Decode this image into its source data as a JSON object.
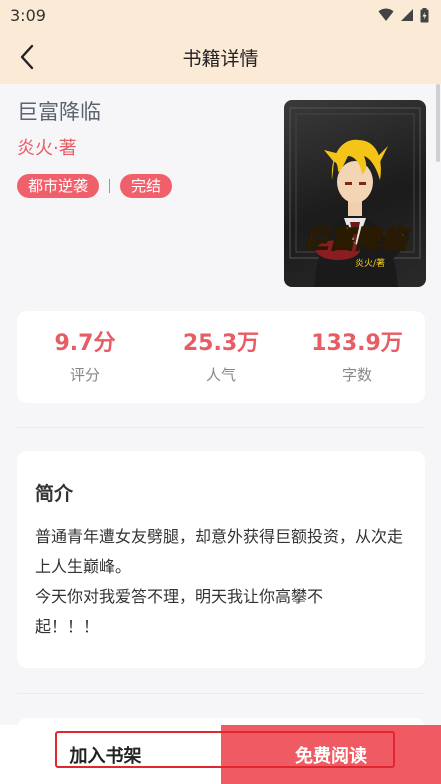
{
  "status_bar": {
    "time": "3:09"
  },
  "header": {
    "title": "书籍详情"
  },
  "book": {
    "title": "巨富降临",
    "author": "炎火·著",
    "tags": [
      "都市逆袭",
      "完结"
    ],
    "cover_title": "巨富降临",
    "cover_author": "炎火/著"
  },
  "stats": [
    {
      "value": "9.7分",
      "label": "评分"
    },
    {
      "value": "25.3万",
      "label": "人气"
    },
    {
      "value": "133.9万",
      "label": "字数"
    }
  ],
  "intro": {
    "heading": "简介",
    "line1": "普通青年遭女友劈腿，却意外获得巨额投资，从次走上人生巅峰。",
    "line2": "今天你对我爱答不理，明天我让你高攀不起！！！"
  },
  "actions": {
    "add_shelf": "加入书架",
    "read_free": "免费阅读"
  },
  "colors": {
    "accent": "#f05a62",
    "header_bg": "#fbead5",
    "author": "#e85c64"
  }
}
